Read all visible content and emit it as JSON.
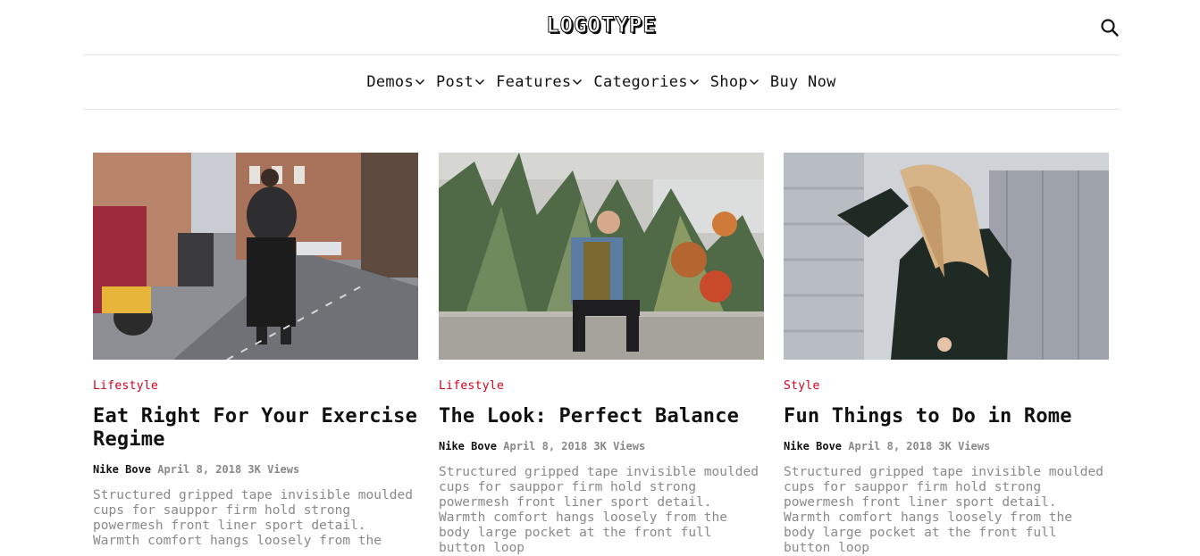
{
  "header": {
    "logo": "LOGOTYPE",
    "search_icon": "search-icon"
  },
  "nav": {
    "items": [
      {
        "label": "Demos",
        "has_dropdown": true
      },
      {
        "label": "Post",
        "has_dropdown": true
      },
      {
        "label": "Features",
        "has_dropdown": true
      },
      {
        "label": "Categories",
        "has_dropdown": true
      },
      {
        "label": "Shop",
        "has_dropdown": true
      },
      {
        "label": "Buy Now",
        "has_dropdown": false
      }
    ]
  },
  "accent_color": "#d0021b",
  "posts": [
    {
      "category": "Lifestyle",
      "title": "Eat Right For Your Exercise Regime",
      "author": "Nike Bove",
      "date": "April 8, 2018",
      "views": "3K Views",
      "excerpt": "Structured gripped tape invisible moulded cups for sauppor firm hold strong powermesh front liner sport detail. Warmth comfort hangs loosely from the"
    },
    {
      "category": "Lifestyle",
      "title": "The Look: Perfect Balance",
      "author": "Nike Bove",
      "date": "April 8, 2018",
      "views": "3K Views",
      "excerpt": "Structured gripped tape invisible moulded cups for sauppor firm hold strong powermesh front liner sport detail. Warmth comfort hangs loosely from the body large pocket at the front full button loop"
    },
    {
      "category": "Style",
      "title": "Fun Things to Do in Rome",
      "author": "Nike Bove",
      "date": "April 8, 2018",
      "views": "3K Views",
      "excerpt": "Structured gripped tape invisible moulded cups for sauppor firm hold strong powermesh front liner sport detail. Warmth comfort hangs loosely from the body large pocket at the front full button loop"
    }
  ]
}
